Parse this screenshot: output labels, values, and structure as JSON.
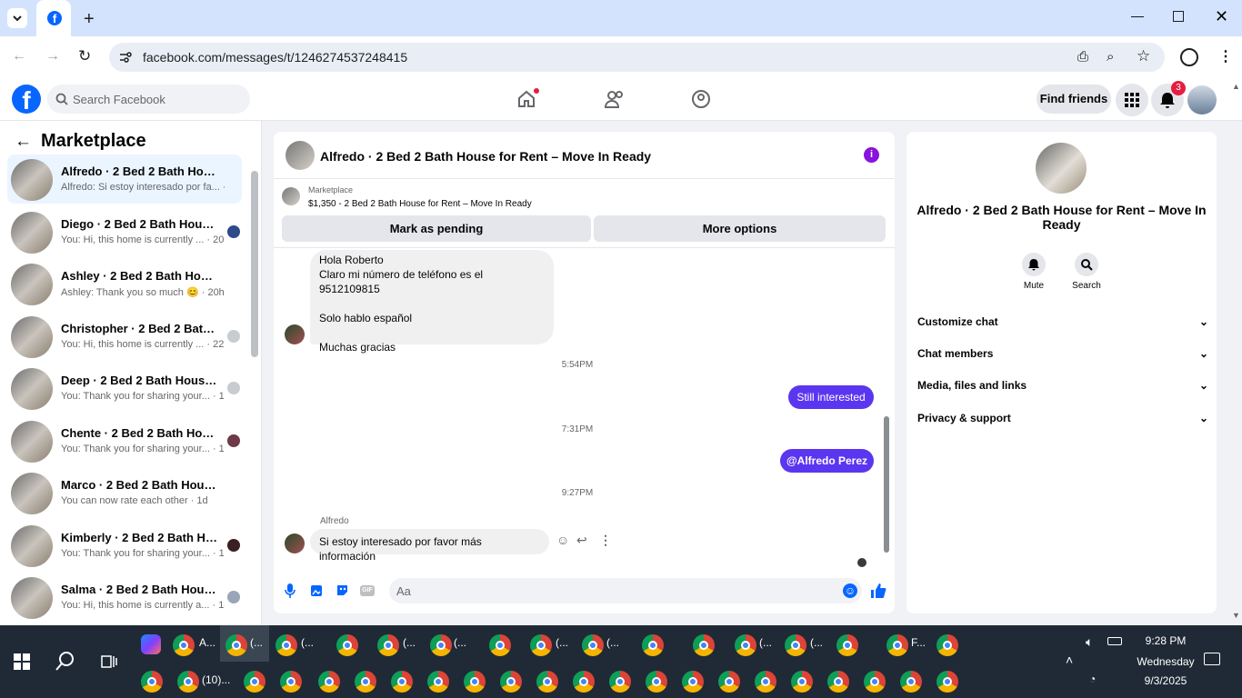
{
  "browser": {
    "url": "facebook.com/messages/t/1246274537248415"
  },
  "fb": {
    "search_placeholder": "Search Facebook",
    "find_friends": "Find friends",
    "notif_count": "3"
  },
  "sidebar": {
    "title": "Marketplace",
    "conversations": [
      {
        "name": "Alfredo · 2 Bed 2 Bath House fo...",
        "preview": "Alfredo: Si estoy interesado por fa... · 1m",
        "active": true
      },
      {
        "name": "Diego · 2 Bed 2 Bath House f...",
        "preview": "You: Hi, this home is currently ... · 20h"
      },
      {
        "name": "Ashley · 2 Bed 2 Bath House for...",
        "preview": "Ashley: Thank you so much 😊 · 20h"
      },
      {
        "name": "Christopher · 2 Bed 2 Bath H...",
        "preview": "You: Hi, this home is currently ... · 22h"
      },
      {
        "name": "Deep · 2 Bed 2 Bath House fo...",
        "preview": "You: Thank you for sharing your... · 1d"
      },
      {
        "name": "Chente · 2 Bed 2 Bath House ...",
        "preview": "You: Thank you for sharing your... · 1d"
      },
      {
        "name": "Marco · 2 Bed 2 Bath House for ...",
        "preview": "You can now rate each other · 1d"
      },
      {
        "name": "Kimberly · 2 Bed 2 Bath Hous...",
        "preview": "You: Thank you for sharing your... · 1d"
      },
      {
        "name": "Salma · 2 Bed 2 Bath House f...",
        "preview": "You: Hi, this home is currently a... · 1d"
      }
    ]
  },
  "chat": {
    "title": "Alfredo · 2 Bed 2 Bath House for Rent – Move In Ready",
    "listing_label": "Marketplace",
    "listing_detail": "$1,350 - 2 Bed 2 Bath House for Rent – Move In Ready",
    "mark_pending": "Mark as pending",
    "more_options": "More options",
    "msg1": [
      "Hola Roberto",
      "Claro mi número de teléfono es el 9512109815",
      "",
      "Solo hablo español",
      "",
      "Muchas gracias"
    ],
    "time1": "5:54PM",
    "msg2": "Still interested",
    "time2": "7:31PM",
    "msg3": "@Alfredo Perez",
    "time3": "9:27PM",
    "sender": "Alfredo",
    "msg4": "Si estoy interesado por favor más información",
    "input_placeholder": "Aa"
  },
  "info": {
    "title": "Alfredo · 2 Bed 2 Bath House for Rent – Move In Ready",
    "mute": "Mute",
    "search": "Search",
    "sections": [
      "Customize chat",
      "Chat members",
      "Media, files and links",
      "Privacy & support"
    ]
  },
  "taskbar": {
    "time": "9:28 PM",
    "day": "Wednesday",
    "date": "9/3/2025",
    "item1": "A...",
    "item2": "(...",
    "item3": "(...",
    "item4": "(...",
    "item5": "(...",
    "item6": "(...",
    "item7": "(...",
    "item8": "(...",
    "item9": "F...",
    "item10": "(10)..."
  },
  "colors": {
    "accent": "#0866ff",
    "messenger": "#5b36f0",
    "purple": "#8a12dc",
    "notif": "#e41e3f"
  }
}
